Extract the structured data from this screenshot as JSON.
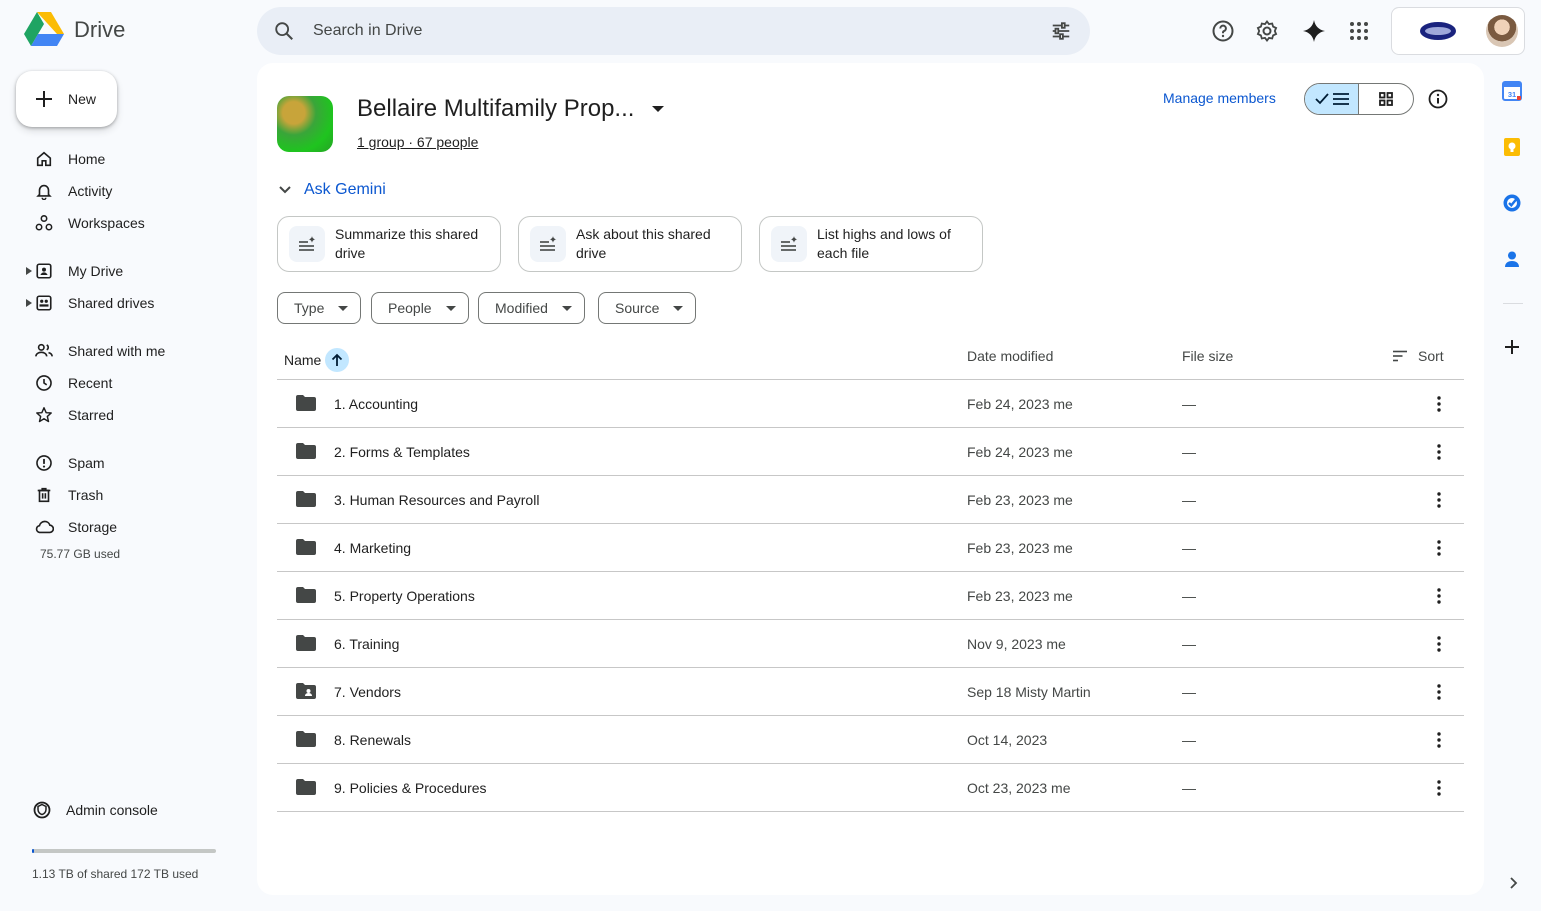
{
  "app": {
    "name": "Drive"
  },
  "search": {
    "placeholder": "Search in Drive"
  },
  "nav": {
    "new_label": "New",
    "items": [
      {
        "label": "Home",
        "icon": "home-icon"
      },
      {
        "label": "Activity",
        "icon": "bell-icon"
      },
      {
        "label": "Workspaces",
        "icon": "workspaces-icon"
      },
      {
        "label": "My Drive",
        "icon": "my-drive-icon"
      },
      {
        "label": "Shared drives",
        "icon": "shared-drives-icon"
      },
      {
        "label": "Shared with me",
        "icon": "people-icon"
      },
      {
        "label": "Recent",
        "icon": "clock-icon"
      },
      {
        "label": "Starred",
        "icon": "star-icon"
      },
      {
        "label": "Spam",
        "icon": "spam-icon"
      },
      {
        "label": "Trash",
        "icon": "trash-icon"
      },
      {
        "label": "Storage",
        "icon": "cloud-icon"
      }
    ],
    "storage_used": "75.77 GB used",
    "admin_console": "Admin console",
    "shared_storage": "1.13 TB of shared 172 TB used",
    "shared_storage_fraction": 0.0066
  },
  "drive": {
    "title": "Bellaire Multifamily Prop...",
    "members": "1 group · 67 people",
    "manage_members": "Manage members"
  },
  "gemini": {
    "label": "Ask Gemini",
    "chips": [
      {
        "text": "Summarize this shared drive"
      },
      {
        "text": "Ask about this shared drive"
      },
      {
        "text": "List highs and lows of each file"
      }
    ]
  },
  "filters": [
    "Type",
    "People",
    "Modified",
    "Source"
  ],
  "table": {
    "headers": {
      "name": "Name",
      "date": "Date modified",
      "size": "File size",
      "sort": "Sort"
    },
    "rows": [
      {
        "name": "1. Accounting",
        "date": "Feb 24, 2023 me",
        "size": "—",
        "type": "folder"
      },
      {
        "name": "2. Forms & Templates",
        "date": "Feb 24, 2023 me",
        "size": "—",
        "type": "folder"
      },
      {
        "name": "3. Human Resources and Payroll",
        "date": "Feb 23, 2023 me",
        "size": "—",
        "type": "folder"
      },
      {
        "name": "4. Marketing",
        "date": "Feb 23, 2023 me",
        "size": "—",
        "type": "folder"
      },
      {
        "name": "5. Property Operations",
        "date": "Feb 23, 2023 me",
        "size": "—",
        "type": "folder"
      },
      {
        "name": "6. Training",
        "date": "Nov 9, 2023 me",
        "size": "—",
        "type": "folder"
      },
      {
        "name": "7. Vendors",
        "date": "Sep 18 Misty Martin",
        "size": "—",
        "type": "shared-folder"
      },
      {
        "name": "8. Renewals",
        "date": "Oct 14, 2023",
        "size": "—",
        "type": "folder"
      },
      {
        "name": "9. Policies & Procedures",
        "date": "Oct 23, 2023 me",
        "size": "—",
        "type": "folder"
      }
    ]
  },
  "side_panel": [
    "calendar-icon",
    "keep-icon",
    "tasks-icon",
    "contacts-icon",
    "add-icon"
  ],
  "colors": {
    "accent": "#0b57d0",
    "selected": "#c2e7ff",
    "background": "#f8fafd"
  }
}
